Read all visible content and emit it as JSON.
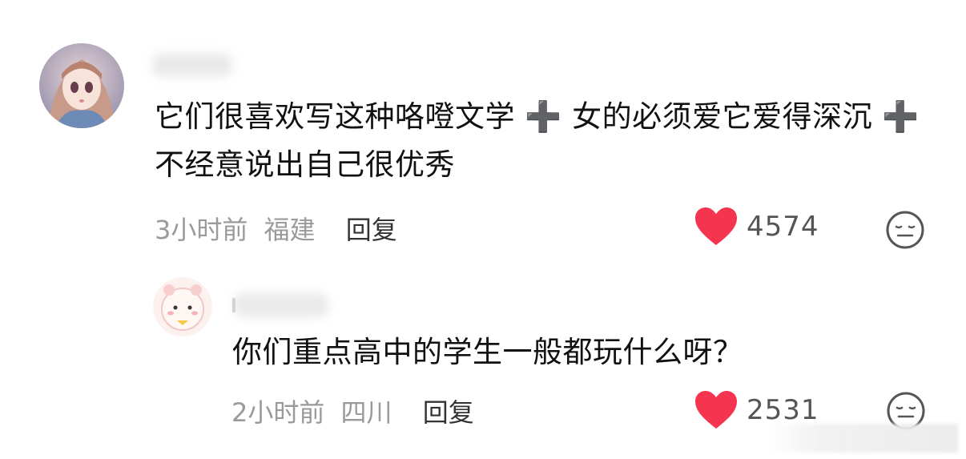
{
  "comments": [
    {
      "text": "它们很喜欢写这种咯噔文学 ➕ 女的必须爱它爱得深沉 ➕ 不经意说出自己很优秀",
      "time": "3小时前",
      "location": "福建",
      "reply_label": "回复",
      "likes": "4574",
      "like_icon": "heart-icon",
      "react_icon": "expressionless-face-icon"
    },
    {
      "text": "你们重点高中的学生一般都玩什么呀？",
      "time": "2小时前",
      "location": "四川",
      "reply_label": "回复",
      "likes": "2531",
      "like_icon": "heart-icon",
      "react_icon": "expressionless-face-icon"
    }
  ],
  "colors": {
    "heart": "#f5354f",
    "meta_text": "#9a9a9a",
    "body_text": "#111111",
    "reply_text": "#333333"
  }
}
